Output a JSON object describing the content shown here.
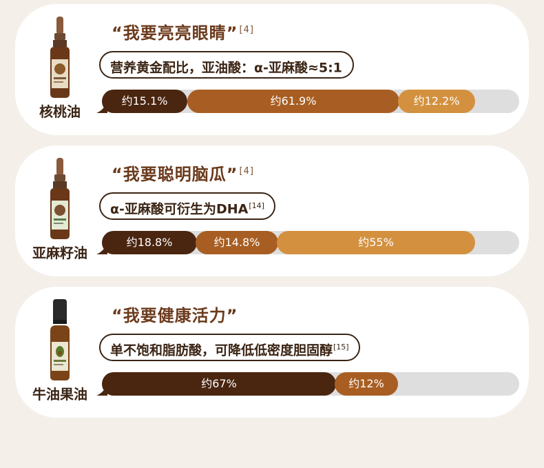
{
  "colors": {
    "background": "#f4efe9",
    "card": "#ffffff",
    "text_dark": "#3a2414",
    "headline": "#6b3a1c",
    "segment_dark": "#4a2510",
    "segment_mid": "#a85e22",
    "segment_light": "#d3913f",
    "track": "#dedede"
  },
  "cards": [
    {
      "oil_name": "核桃油",
      "headline": "“我要亮亮眼睛”",
      "headline_ref": "[4]",
      "pill_text": "营养黄金配比，亚油酸：α-亚麻酸≈5:1",
      "pill_ref": "",
      "bottle_icon": "dropper-bottle-icon",
      "segments": [
        {
          "label": "约15.1%",
          "value": 15.1
        },
        {
          "label": "约61.9%",
          "value": 61.9
        },
        {
          "label": "约12.2%",
          "value": 12.2
        }
      ]
    },
    {
      "oil_name": "亚麻籽油",
      "headline": "“我要聪明脑瓜”",
      "headline_ref": "[4]",
      "pill_text": "α-亚麻酸可衍生为DHA",
      "pill_ref": "[14]",
      "bottle_icon": "dropper-bottle-icon",
      "segments": [
        {
          "label": "约18.8%",
          "value": 18.8
        },
        {
          "label": "约14.8%",
          "value": 14.8
        },
        {
          "label": "约55%",
          "value": 55
        }
      ]
    },
    {
      "oil_name": "牛油果油",
      "headline": "“我要健康活力”",
      "headline_ref": "",
      "pill_text": "单不饱和脂肪酸，可降低低密度胆固醇",
      "pill_ref": "[15]",
      "bottle_icon": "cap-bottle-icon",
      "segments": [
        {
          "label": "约67%",
          "value": 67
        },
        {
          "label": "约12%",
          "value": 12
        }
      ]
    }
  ]
}
